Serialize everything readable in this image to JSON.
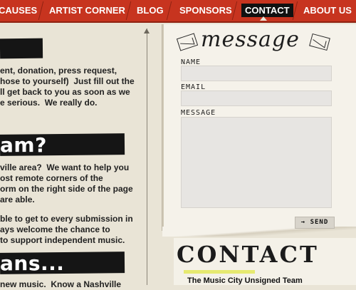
{
  "nav": {
    "items": [
      {
        "label": "CAUSES"
      },
      {
        "label": "ARTIST CORNER"
      },
      {
        "label": "BLOG"
      },
      {
        "label": "SPONSORS"
      },
      {
        "label": "CONTACT"
      },
      {
        "label": "ABOUT US"
      }
    ],
    "active": "CONTACT"
  },
  "left": {
    "intro_lines": "ent, donation, press request,\nhose to yourself)  Just fill out the\nll get back to you as soon as we\ne serious.  We really do.",
    "team_heading": "am?",
    "team_lines": "ville area?  We want to help you\nost remote corners of the\norm on the right side of the page\nare able.",
    "team_lines2": "ble to get to every submission in\nays welcome the chance to\nto support independent music.",
    "fans_heading": "ans...",
    "fans_line": "new music.  Know a Nashville"
  },
  "form": {
    "title": "message",
    "name_label": "Name",
    "name_value": "",
    "email_label": "Email",
    "email_value": "",
    "message_label": "Message",
    "message_value": "",
    "send_label": "→ SEND"
  },
  "contact": {
    "heading": "CONTACT",
    "subheading": "The Music City Unsigned Team"
  },
  "colors": {
    "nav_red": "#c7341f",
    "paper": "#e9e4d6",
    "ink": "#151515",
    "highlight": "#e3e85a"
  }
}
